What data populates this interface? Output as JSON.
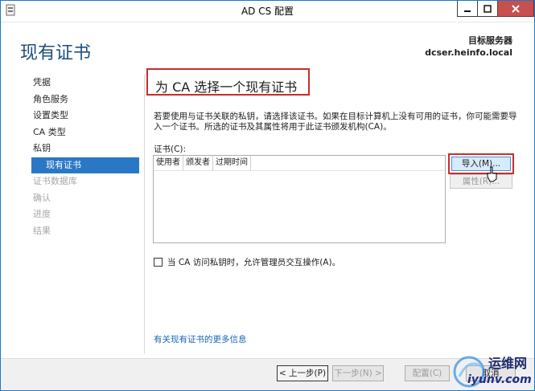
{
  "window": {
    "title": "AD CS 配置",
    "controls": {
      "minimize_icon": "minimize-icon",
      "maximize_icon": "maximize-icon",
      "close_icon": "close-icon"
    }
  },
  "header": {
    "page_title": "现有证书",
    "target_label": "目标服务器",
    "target_server": "dcser.heinfo.local"
  },
  "nav": {
    "items": [
      {
        "label": "凭据",
        "state": "normal"
      },
      {
        "label": "角色服务",
        "state": "normal"
      },
      {
        "label": "设置类型",
        "state": "normal"
      },
      {
        "label": "CA 类型",
        "state": "normal"
      },
      {
        "label": "私钥",
        "state": "normal"
      },
      {
        "label": "现有证书",
        "state": "active"
      },
      {
        "label": "证书数据库",
        "state": "disabled"
      },
      {
        "label": "确认",
        "state": "disabled"
      },
      {
        "label": "进度",
        "state": "disabled"
      },
      {
        "label": "结果",
        "state": "disabled"
      }
    ]
  },
  "content": {
    "section_title": "为 CA 选择一个现有证书",
    "description": "若要使用与证书关联的私钥，请选择该证书。如果在目标计算机上没有可用的证书，你可能需要导入一个证书。所选的证书及其属性将用于此证书颁发机构(CA)。",
    "cert_label": "证书(C):",
    "columns": [
      "使用者",
      "颁发者",
      "过期时间"
    ],
    "import_button": "导入(M)...",
    "properties_button": "属性(R)...",
    "allow_interaction_label": "当 CA 访问私钥时，允许管理员交互操作(A)。",
    "allow_interaction_checked": false,
    "more_info_link": "有关现有证书的更多信息"
  },
  "footer": {
    "prev_button": "< 上一步(P)",
    "next_button": "下一步(N) >",
    "configure_button": "配置(C)",
    "cancel_button": "取消"
  },
  "watermark": {
    "brand": "运维网",
    "url": "iyunv.com"
  },
  "colors": {
    "accent": "#2a78c5",
    "highlight_border": "#cc2b2b",
    "title_blue": "#1e4f7a",
    "link": "#1766b8",
    "close_button": "#c7504f"
  }
}
